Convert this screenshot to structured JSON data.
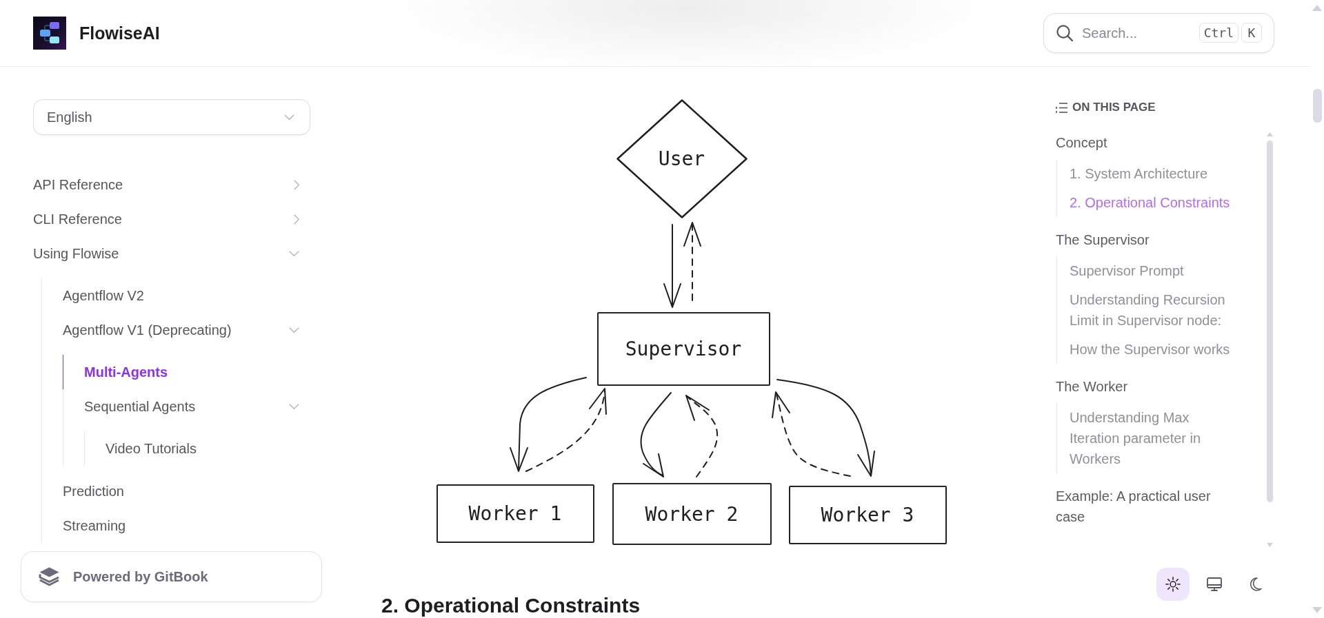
{
  "header": {
    "title": "FlowiseAI",
    "search": {
      "placeholder": "Search...",
      "keys": [
        "Ctrl",
        "K"
      ]
    }
  },
  "sidebar": {
    "language": "English",
    "items": [
      {
        "label": "API Reference",
        "selected": false,
        "expanded": false
      },
      {
        "label": "CLI Reference",
        "selected": false,
        "expanded": false
      },
      {
        "label": "Using Flowise",
        "selected": false,
        "expanded": true,
        "children": [
          {
            "label": "Agentflow V2",
            "selected": false
          },
          {
            "label": "Agentflow V1 (Deprecating)",
            "selected": false,
            "expanded": true,
            "children": [
              {
                "label": "Multi-Agents",
                "selected": true
              },
              {
                "label": "Sequential Agents",
                "selected": false,
                "expanded": true,
                "children": [
                  {
                    "label": "Video Tutorials",
                    "selected": false
                  }
                ]
              }
            ]
          },
          {
            "label": "Prediction",
            "selected": false
          },
          {
            "label": "Streaming",
            "selected": false
          }
        ]
      }
    ],
    "badge": "Powered by GitBook"
  },
  "content": {
    "diagram": {
      "nodes": [
        {
          "kind": "diamond",
          "label": "User"
        },
        {
          "kind": "box",
          "label": "Supervisor"
        },
        {
          "kind": "box",
          "label": "Worker 1"
        },
        {
          "kind": "box",
          "label": "Worker 2"
        },
        {
          "kind": "box",
          "label": "Worker 3"
        }
      ]
    },
    "heading": "2. Operational Constraints"
  },
  "toc": {
    "title": "ON THIS PAGE",
    "items": [
      {
        "label": "Concept",
        "selected": false,
        "children": [
          {
            "label": "1. System Architecture",
            "selected": false
          },
          {
            "label": "2. Operational Constraints",
            "selected": true
          }
        ]
      },
      {
        "label": "The Supervisor",
        "selected": false,
        "children": [
          {
            "label": "Supervisor Prompt",
            "selected": false
          },
          {
            "label": "Understanding Recursion Limit in Supervisor node:",
            "selected": false
          },
          {
            "label": "How the Supervisor works",
            "selected": false
          }
        ]
      },
      {
        "label": "The Worker",
        "selected": false,
        "children": [
          {
            "label": "Understanding Max Iteration parameter in Workers",
            "selected": false
          }
        ]
      },
      {
        "label": "Example: A practical user case",
        "selected": false
      }
    ]
  },
  "theme_buttons": [
    {
      "kind": "light",
      "selected": true
    },
    {
      "kind": "system",
      "selected": false
    },
    {
      "kind": "dark",
      "selected": false
    }
  ]
}
